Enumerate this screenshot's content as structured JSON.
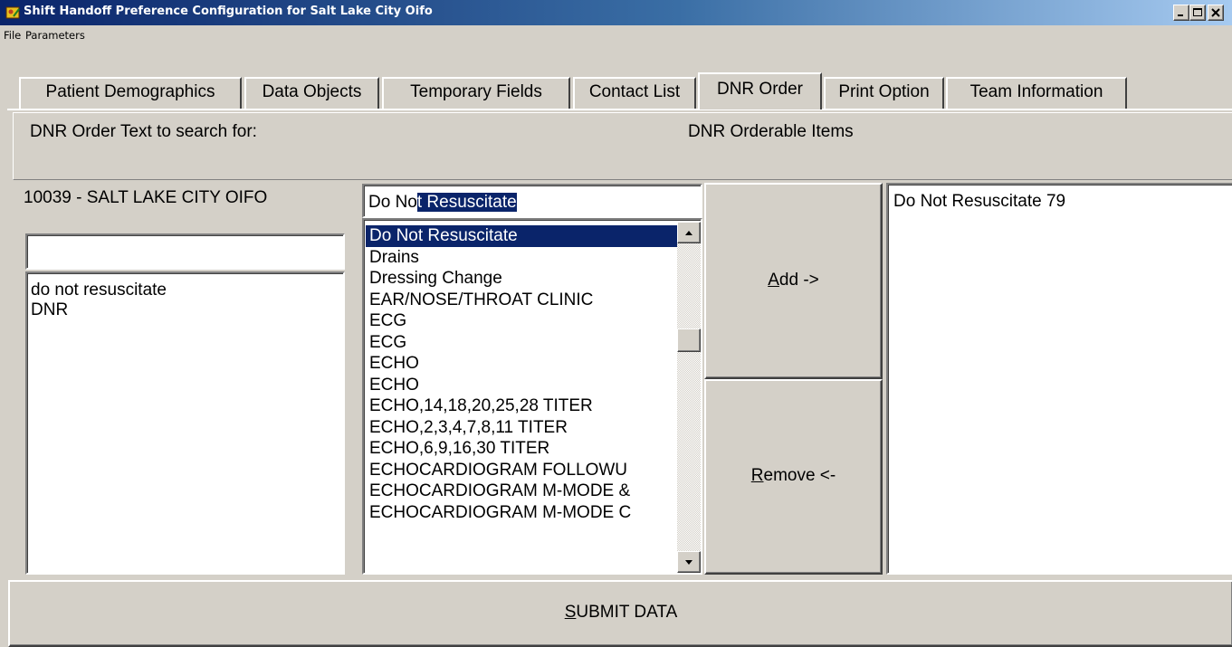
{
  "window": {
    "title": "Shift Handoff Preference Configuration for Salt Lake City Oifo",
    "controls": {
      "minimize": "_",
      "maximize": "□",
      "close": "×"
    }
  },
  "menu": [
    "File",
    "Parameters"
  ],
  "tabs": [
    {
      "label": "Patient Demographics",
      "active": false
    },
    {
      "label": "Data Objects",
      "active": false
    },
    {
      "label": "Temporary Fields",
      "active": false
    },
    {
      "label": "Contact List",
      "active": false
    },
    {
      "label": "DNR Order",
      "active": true
    },
    {
      "label": "Print Option",
      "active": false
    },
    {
      "label": "Team Information",
      "active": false
    }
  ],
  "header": {
    "search_label": "DNR Order Text to search for:",
    "orderable_label": "DNR Orderable Items"
  },
  "left": {
    "station": "10039 - SALT LAKE CITY OIFO",
    "input_value": "",
    "search_terms": [
      "do not resuscitate",
      "DNR"
    ]
  },
  "middle": {
    "input_typed": "Do No",
    "input_selected": "t Resuscitate",
    "items": [
      "Do Not Resuscitate",
      "Drains",
      "Dressing Change",
      "EAR/NOSE/THROAT CLINIC",
      "ECG",
      "ECG",
      "ECHO",
      "ECHO",
      "ECHO,14,18,20,25,28 TITER",
      "ECHO,2,3,4,7,8,11 TITER",
      "ECHO,6,9,16,30 TITER",
      "ECHOCARDIOGRAM FOLLOWU",
      "ECHOCARDIOGRAM M-MODE &",
      "ECHOCARDIOGRAM M-MODE C"
    ],
    "selected_index": 0
  },
  "buttons": {
    "add_accel": "A",
    "add_rest": "dd ->",
    "remove_accel": "R",
    "remove_rest": "emove <-",
    "submit_accel": "S",
    "submit_rest": "UBMIT DATA"
  },
  "right": {
    "items": [
      "Do Not Resuscitate 79"
    ]
  },
  "colors": {
    "face": "#d4d0c8",
    "highlight": "#0a246a",
    "title_gradient_end": "#a6caf0"
  }
}
